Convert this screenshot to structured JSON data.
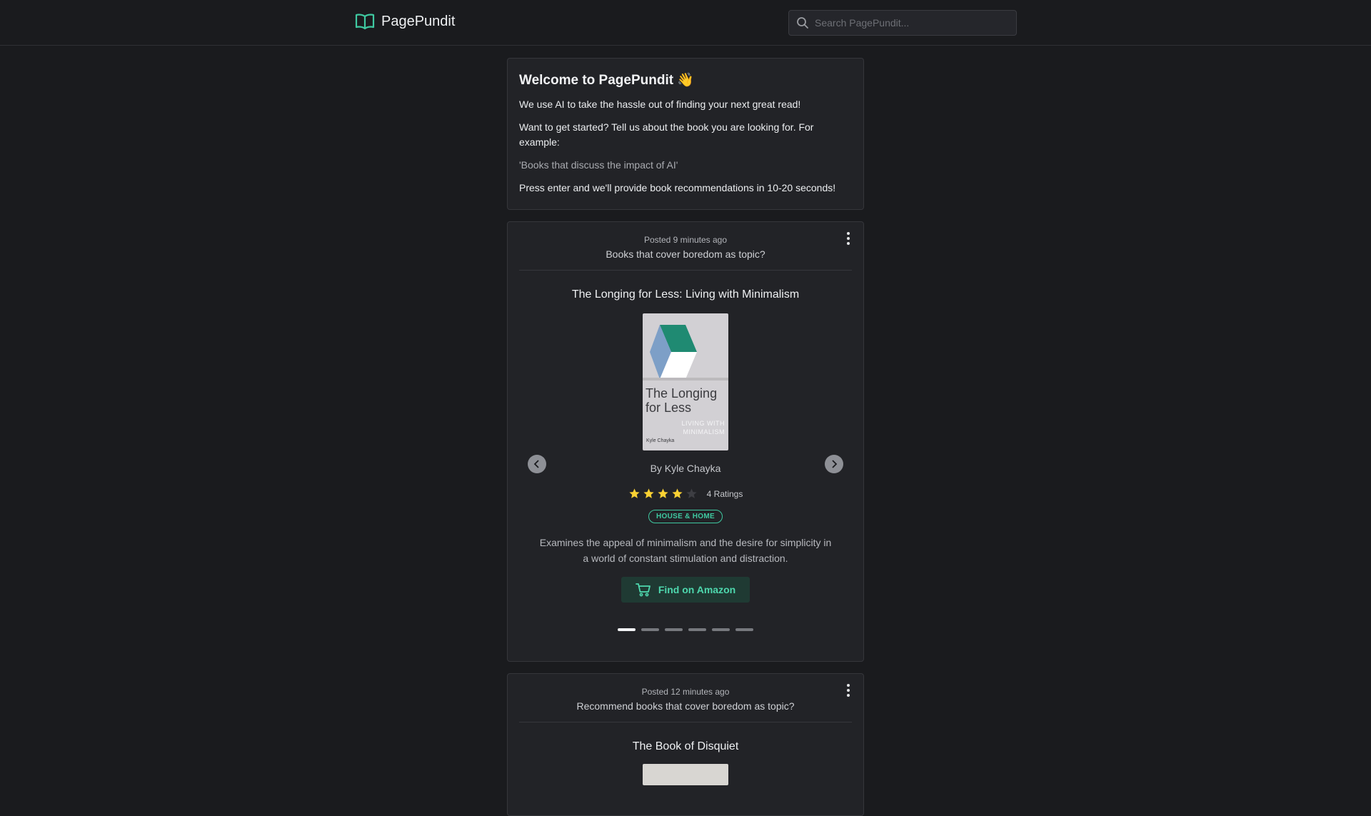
{
  "header": {
    "brand": "PagePundit",
    "brand_icon": "open-book-icon",
    "search_placeholder": "Search PagePundit...",
    "accent_color": "#3fc9a1"
  },
  "welcome": {
    "title": "Welcome to PagePundit 👋",
    "line1": "We use AI to take the hassle out of finding your next great read!",
    "line2": "Want to get started? Tell us about the book you are looking for. For example:",
    "example": "'Books that discuss the impact of AI'",
    "line3": "Press enter and we'll provide book recommendations in 10-20 seconds!"
  },
  "posts": [
    {
      "posted": "Posted 9 minutes ago",
      "query": "Books that cover boredom as topic?",
      "book": {
        "title": "The Longing for Less: Living with Minimalism",
        "cover_title": "The Longing for Less",
        "cover_subtitle": "LIVING WITH MINIMALISM",
        "cover_author": "Kyle Chayka",
        "author": "By Kyle Chayka",
        "rating_stars": 4,
        "rating_max": 5,
        "ratings": "4 Ratings",
        "category": "HOUSE & HOME",
        "description": "Examines the appeal of minimalism and the desire for simplicity in a world of constant stimulation and distraction.",
        "cta": "Find on Amazon"
      },
      "carousel": {
        "total": 6,
        "active": 1
      }
    },
    {
      "posted": "Posted 12 minutes ago",
      "query": "Recommend books that cover boredom as topic?",
      "book": {
        "title": "The Book of Disquiet"
      }
    }
  ]
}
